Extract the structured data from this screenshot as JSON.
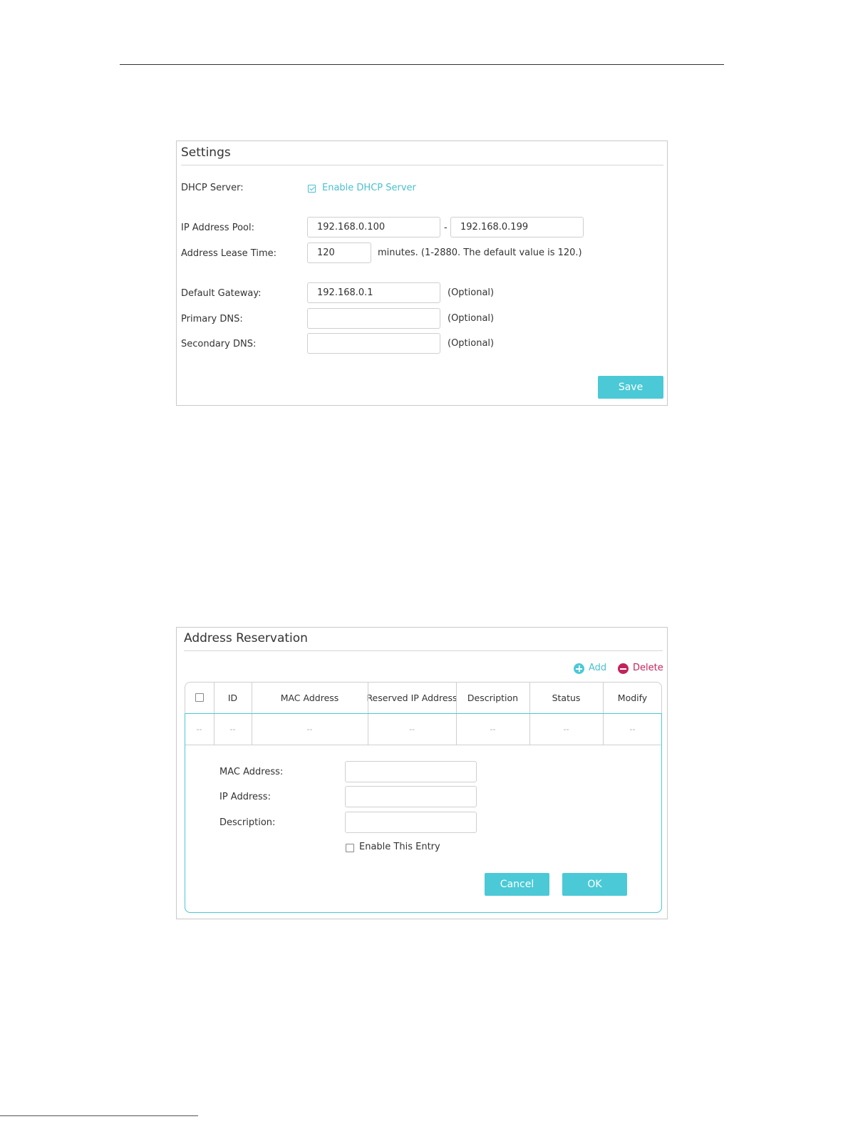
{
  "settings": {
    "title": "Settings",
    "dhcp_server_label": "DHCP Server:",
    "enable_dhcp_label": "Enable DHCP Server",
    "enable_dhcp_checked": true,
    "ip_pool_label": "IP Address Pool:",
    "ip_pool_start": "192.168.0.100",
    "ip_pool_separator": "-",
    "ip_pool_end": "192.168.0.199",
    "lease_time_label": "Address Lease Time:",
    "lease_time_value": "120",
    "lease_time_hint": "minutes. (1-2880. The default value is 120.)",
    "gateway_label": "Default Gateway:",
    "gateway_value": "192.168.0.1",
    "primary_dns_label": "Primary DNS:",
    "primary_dns_value": "",
    "secondary_dns_label": "Secondary DNS:",
    "secondary_dns_value": "",
    "optional_hint": "(Optional)",
    "save_label": "Save"
  },
  "reservation": {
    "title": "Address Reservation",
    "add_label": "Add",
    "delete_label": "Delete",
    "columns": [
      "ID",
      "MAC Address",
      "Reserved IP Address",
      "Description",
      "Status",
      "Modify"
    ],
    "row": [
      "--",
      "--",
      "--",
      "--",
      "--",
      "--",
      "--"
    ],
    "form": {
      "mac_label": "MAC Address:",
      "mac_value": "",
      "ip_label": "IP Address:",
      "ip_value": "",
      "description_label": "Description:",
      "description_value": "",
      "enable_entry_label": "Enable This Entry",
      "enable_entry_checked": false,
      "cancel_label": "Cancel",
      "ok_label": "OK"
    }
  },
  "colors": {
    "accent": "#4bc9d6",
    "delete": "#c0245c"
  }
}
